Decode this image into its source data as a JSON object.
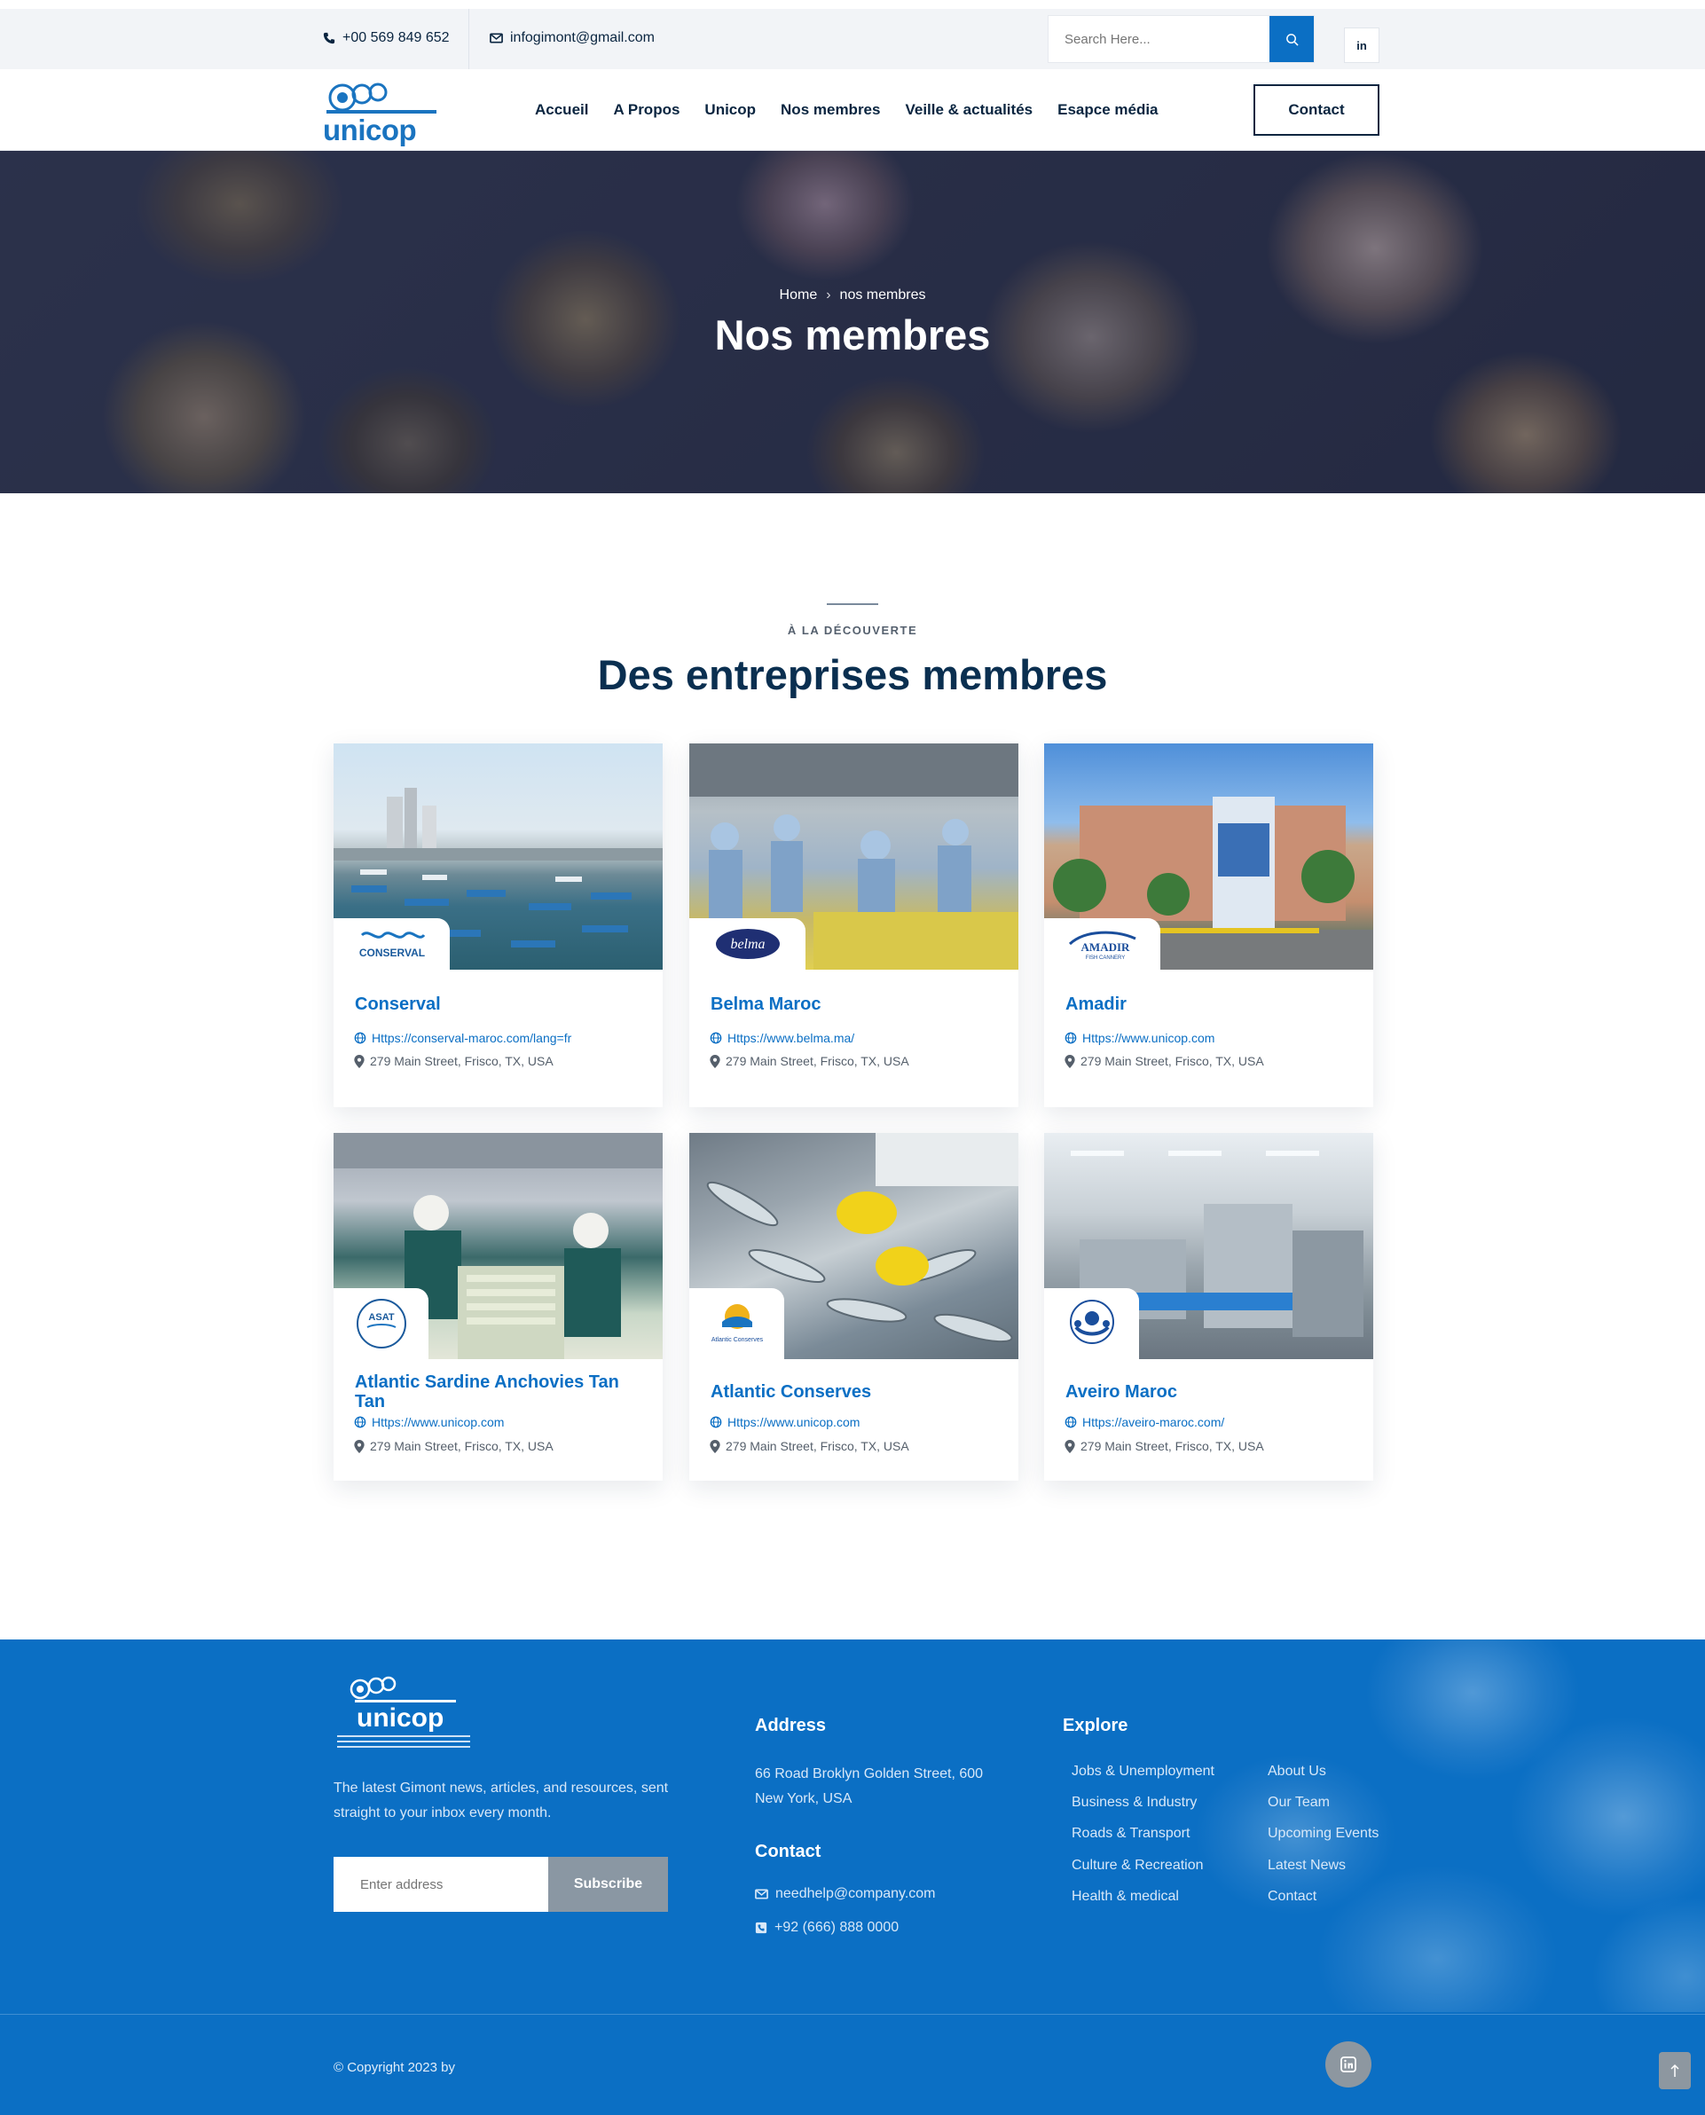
{
  "topbar": {
    "phone": "+00 569 849 652",
    "email": "infogimont@gmail.com",
    "search_placeholder": "Search Here...",
    "social_label": "in"
  },
  "nav": {
    "logo_text": "unicop",
    "links": [
      "Accueil",
      "A Propos",
      "Unicop",
      "Nos membres",
      "Veille & actualités",
      "Esapce média"
    ],
    "contact_label": "Contact"
  },
  "hero": {
    "breadcrumb_home": "Home",
    "breadcrumb_sep": "›",
    "breadcrumb_current": "nos membres",
    "title": "Nos membres"
  },
  "section": {
    "subtitle": "À LA DÉCOUVERTE",
    "title": "Des entreprises membres"
  },
  "members": [
    {
      "name": "Conserval",
      "url": "Https://conserval-maroc.com/lang=fr",
      "address": "279 Main Street, Frisco, TX, USA",
      "logo": "CONSERVAL"
    },
    {
      "name": "Belma Maroc",
      "url": "Https://www.belma.ma/",
      "address": "279 Main Street, Frisco, TX, USA",
      "logo": "belma"
    },
    {
      "name": "Amadir",
      "url": "Https://www.unicop.com",
      "address": "279 Main Street, Frisco, TX, USA",
      "logo": "AMADIR"
    },
    {
      "name": "Atlantic Sardine Anchovies Tan Tan",
      "url": "Https://www.unicop.com",
      "address": "279 Main Street, Frisco, TX, USA",
      "logo": "ASAT"
    },
    {
      "name": "Atlantic Conserves",
      "url": "Https://www.unicop.com",
      "address": "279 Main Street, Frisco, TX, USA",
      "logo": "Atlantic Conserves"
    },
    {
      "name": "Aveiro Maroc",
      "url": "Https://aveiro-maroc.com/",
      "address": "279 Main Street, Frisco, TX, USA",
      "logo": "AVEIRO MAROC"
    }
  ],
  "footer": {
    "logo_text": "unicop",
    "description": "The latest Gimont news, articles, and resources, sent straight to your inbox every month.",
    "email_placeholder": "Enter address",
    "subscribe_label": "Subscribe",
    "address_heading": "Address",
    "address_text": "66 Road Broklyn Golden Street, 600 New York, USA",
    "contact_heading": "Contact",
    "contact_email": "needhelp@company.com",
    "contact_phone": "+92 (666) 888 0000",
    "explore_heading": "Explore",
    "explore_col1": [
      "Jobs & Unemployment",
      "Business & Industry",
      "Roads & Transport",
      "Culture & Recreation",
      "Health & medical"
    ],
    "explore_col2": [
      "About Us",
      "Our Team",
      "Upcoming Events",
      "Latest News",
      "Contact"
    ],
    "copyright": "© Copyright 2023 by"
  },
  "colors": {
    "primary": "#0b6fc4",
    "navy": "#0a2540",
    "topbar_bg": "#f2f4f7"
  },
  "icons": [
    "phone-icon",
    "mail-icon",
    "search-icon",
    "linkedin-icon",
    "globe-icon",
    "pin-icon",
    "arrow-up-icon"
  ]
}
